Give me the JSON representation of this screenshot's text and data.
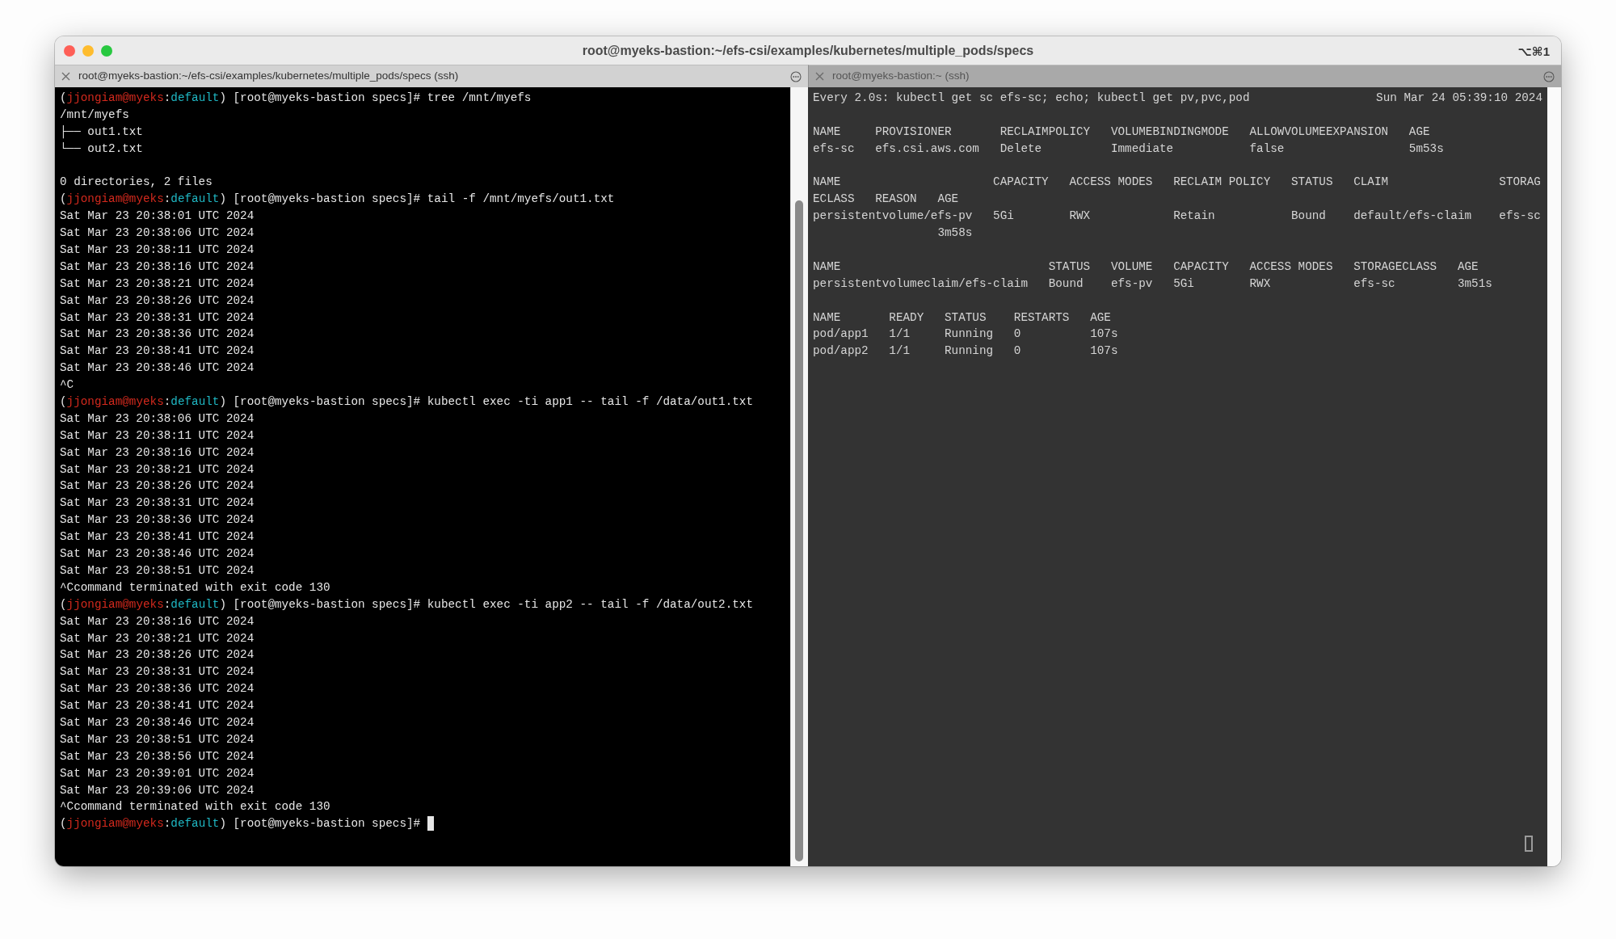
{
  "window": {
    "title": "root@myeks-bastion:~/efs-csi/examples/kubernetes/multiple_pods/specs",
    "shortcut": "⌥⌘1"
  },
  "tabs": [
    {
      "label": "root@myeks-bastion:~/efs-csi/examples/kubernetes/multiple_pods/specs (ssh)",
      "selected": true
    },
    {
      "label": "root@myeks-bastion:~ (ssh)",
      "selected": false
    }
  ],
  "left_pane": {
    "focused": true,
    "lines": [
      {
        "kind": "prompt",
        "segments": [
          {
            "kind": "plain",
            "text": "("
          },
          {
            "kind": "user",
            "text": "jjongiam@myeks"
          },
          {
            "kind": "plain",
            "text": ":"
          },
          {
            "kind": "context",
            "text": "default"
          },
          {
            "kind": "plain",
            "text": ") [root@myeks-bastion specs]# tree /mnt/myefs"
          }
        ]
      },
      {
        "kind": "output",
        "text": "/mnt/myefs"
      },
      {
        "kind": "output",
        "text": "├── out1.txt"
      },
      {
        "kind": "output",
        "text": "└── out2.txt"
      },
      {
        "kind": "blank"
      },
      {
        "kind": "output",
        "text": "0 directories, 2 files"
      },
      {
        "kind": "prompt",
        "segments": [
          {
            "kind": "plain",
            "text": "("
          },
          {
            "kind": "user",
            "text": "jjongiam@myeks"
          },
          {
            "kind": "plain",
            "text": ":"
          },
          {
            "kind": "context",
            "text": "default"
          },
          {
            "kind": "plain",
            "text": ") [root@myeks-bastion specs]# tail -f /mnt/myefs/out1.txt"
          }
        ]
      },
      {
        "kind": "output",
        "text": "Sat Mar 23 20:38:01 UTC 2024"
      },
      {
        "kind": "output",
        "text": "Sat Mar 23 20:38:06 UTC 2024"
      },
      {
        "kind": "output",
        "text": "Sat Mar 23 20:38:11 UTC 2024"
      },
      {
        "kind": "output",
        "text": "Sat Mar 23 20:38:16 UTC 2024"
      },
      {
        "kind": "output",
        "text": "Sat Mar 23 20:38:21 UTC 2024"
      },
      {
        "kind": "output",
        "text": "Sat Mar 23 20:38:26 UTC 2024"
      },
      {
        "kind": "output",
        "text": "Sat Mar 23 20:38:31 UTC 2024"
      },
      {
        "kind": "output",
        "text": "Sat Mar 23 20:38:36 UTC 2024"
      },
      {
        "kind": "output",
        "text": "Sat Mar 23 20:38:41 UTC 2024"
      },
      {
        "kind": "output",
        "text": "Sat Mar 23 20:38:46 UTC 2024"
      },
      {
        "kind": "output",
        "text": "^C"
      },
      {
        "kind": "prompt",
        "segments": [
          {
            "kind": "plain",
            "text": "("
          },
          {
            "kind": "user",
            "text": "jjongiam@myeks"
          },
          {
            "kind": "plain",
            "text": ":"
          },
          {
            "kind": "context",
            "text": "default"
          },
          {
            "kind": "plain",
            "text": ") [root@myeks-bastion specs]# kubectl exec -ti app1 -- tail -f /data/out1.txt"
          }
        ]
      },
      {
        "kind": "output",
        "text": "Sat Mar 23 20:38:06 UTC 2024"
      },
      {
        "kind": "output",
        "text": "Sat Mar 23 20:38:11 UTC 2024"
      },
      {
        "kind": "output",
        "text": "Sat Mar 23 20:38:16 UTC 2024"
      },
      {
        "kind": "output",
        "text": "Sat Mar 23 20:38:21 UTC 2024"
      },
      {
        "kind": "output",
        "text": "Sat Mar 23 20:38:26 UTC 2024"
      },
      {
        "kind": "output",
        "text": "Sat Mar 23 20:38:31 UTC 2024"
      },
      {
        "kind": "output",
        "text": "Sat Mar 23 20:38:36 UTC 2024"
      },
      {
        "kind": "output",
        "text": "Sat Mar 23 20:38:41 UTC 2024"
      },
      {
        "kind": "output",
        "text": "Sat Mar 23 20:38:46 UTC 2024"
      },
      {
        "kind": "output",
        "text": "Sat Mar 23 20:38:51 UTC 2024"
      },
      {
        "kind": "output",
        "text": "^Ccommand terminated with exit code 130"
      },
      {
        "kind": "prompt",
        "segments": [
          {
            "kind": "plain",
            "text": "("
          },
          {
            "kind": "user",
            "text": "jjongiam@myeks"
          },
          {
            "kind": "plain",
            "text": ":"
          },
          {
            "kind": "context",
            "text": "default"
          },
          {
            "kind": "plain",
            "text": ") [root@myeks-bastion specs]# kubectl exec -ti app2 -- tail -f /data/out2.txt"
          }
        ]
      },
      {
        "kind": "output",
        "text": "Sat Mar 23 20:38:16 UTC 2024"
      },
      {
        "kind": "output",
        "text": "Sat Mar 23 20:38:21 UTC 2024"
      },
      {
        "kind": "output",
        "text": "Sat Mar 23 20:38:26 UTC 2024"
      },
      {
        "kind": "output",
        "text": "Sat Mar 23 20:38:31 UTC 2024"
      },
      {
        "kind": "output",
        "text": "Sat Mar 23 20:38:36 UTC 2024"
      },
      {
        "kind": "output",
        "text": "Sat Mar 23 20:38:41 UTC 2024"
      },
      {
        "kind": "output",
        "text": "Sat Mar 23 20:38:46 UTC 2024"
      },
      {
        "kind": "output",
        "text": "Sat Mar 23 20:38:51 UTC 2024"
      },
      {
        "kind": "output",
        "text": "Sat Mar 23 20:38:56 UTC 2024"
      },
      {
        "kind": "output",
        "text": "Sat Mar 23 20:39:01 UTC 2024"
      },
      {
        "kind": "output",
        "text": "Sat Mar 23 20:39:06 UTC 2024"
      },
      {
        "kind": "output",
        "text": "^Ccommand terminated with exit code 130"
      },
      {
        "kind": "prompt",
        "segments": [
          {
            "kind": "plain",
            "text": "("
          },
          {
            "kind": "user",
            "text": "jjongiam@myeks"
          },
          {
            "kind": "plain",
            "text": ":"
          },
          {
            "kind": "context",
            "text": "default"
          },
          {
            "kind": "plain",
            "text": ") [root@myeks-bastion specs]# "
          }
        ]
      }
    ]
  },
  "right_pane": {
    "focused": false,
    "header": {
      "command": "Every 2.0s: kubectl get sc efs-sc; echo; kubectl get pv,pvc,pod",
      "time": "Sun Mar 24 05:39:10 2024"
    },
    "blocks": [
      [
        "NAME     PROVISIONER       RECLAIMPOLICY   VOLUMEBINDINGMODE   ALLOWVOLUMEEXPANSION   AGE",
        "efs-sc   efs.csi.aws.com   Delete          Immediate           false                  5m53s"
      ],
      [
        "NAME                      CAPACITY   ACCESS MODES   RECLAIM POLICY   STATUS   CLAIM                STORAG",
        "ECLASS   REASON   AGE",
        "persistentvolume/efs-pv   5Gi        RWX            Retain           Bound    default/efs-claim    efs-sc",
        "                  3m58s"
      ],
      [
        "NAME                              STATUS   VOLUME   CAPACITY   ACCESS MODES   STORAGECLASS   AGE",
        "persistentvolumeclaim/efs-claim   Bound    efs-pv   5Gi        RWX            efs-sc         3m51s"
      ],
      [
        "NAME       READY   STATUS    RESTARTS   AGE",
        "pod/app1   1/1     Running   0          107s",
        "pod/app2   1/1     Running   0          107s"
      ]
    ]
  }
}
